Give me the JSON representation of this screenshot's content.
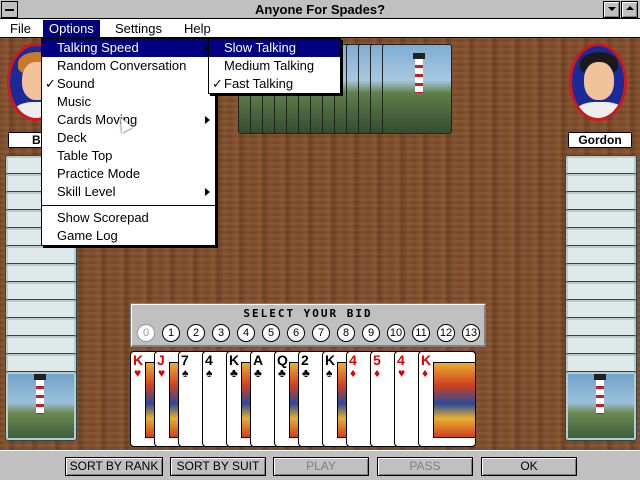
{
  "window": {
    "title": "Anyone For Spades?"
  },
  "menubar": [
    "File",
    "Options",
    "Settings",
    "Help"
  ],
  "options_menu": {
    "items": [
      {
        "label": "Talking Speed",
        "checked": false,
        "submenu": true,
        "highlighted": true
      },
      {
        "label": "Random Conversation",
        "checked": false,
        "submenu": false
      },
      {
        "label": "Sound",
        "checked": true,
        "submenu": false
      },
      {
        "label": "Music",
        "checked": false,
        "submenu": false
      },
      {
        "label": "Cards Moving",
        "checked": false,
        "submenu": true
      },
      {
        "label": "Deck",
        "checked": false,
        "submenu": false
      },
      {
        "label": "Table Top",
        "checked": false,
        "submenu": false
      },
      {
        "label": "Practice Mode",
        "checked": false,
        "submenu": false
      },
      {
        "label": "Skill Level",
        "checked": false,
        "submenu": true
      },
      {
        "label": "Show Scorepad",
        "checked": false,
        "submenu": false
      },
      {
        "label": "Game Log",
        "checked": false,
        "submenu": false
      }
    ]
  },
  "talking_speed_menu": {
    "items": [
      {
        "label": "Slow Talking",
        "checked": false,
        "highlighted": true
      },
      {
        "label": "Medium Talking",
        "checked": false
      },
      {
        "label": "Fast Talking",
        "checked": true
      }
    ]
  },
  "check_mark": "✓",
  "players": {
    "west_name": "Bi",
    "east_name": "Gordon"
  },
  "bid_panel": {
    "title": "SELECT YOUR BID",
    "bids": [
      "0",
      "1",
      "2",
      "3",
      "4",
      "5",
      "6",
      "7",
      "8",
      "9",
      "10",
      "11",
      "12",
      "13"
    ]
  },
  "hand": [
    {
      "rank": "K",
      "suit": "♥",
      "color": "red",
      "face": true
    },
    {
      "rank": "J",
      "suit": "♥",
      "color": "red",
      "face": true
    },
    {
      "rank": "7",
      "suit": "♠",
      "color": "black",
      "face": false
    },
    {
      "rank": "4",
      "suit": "♠",
      "color": "black",
      "face": false
    },
    {
      "rank": "K",
      "suit": "♣",
      "color": "black",
      "face": true
    },
    {
      "rank": "A",
      "suit": "♣",
      "color": "black",
      "face": false
    },
    {
      "rank": "Q",
      "suit": "♣",
      "color": "black",
      "face": true
    },
    {
      "rank": "2",
      "suit": "♣",
      "color": "black",
      "face": false
    },
    {
      "rank": "K",
      "suit": "♠",
      "color": "black",
      "face": true
    },
    {
      "rank": "4",
      "suit": "♦",
      "color": "red",
      "face": false
    },
    {
      "rank": "5",
      "suit": "♦",
      "color": "red",
      "face": false
    },
    {
      "rank": "4",
      "suit": "♥",
      "color": "red",
      "face": false
    },
    {
      "rank": "K",
      "suit": "♦",
      "color": "red",
      "face": true
    }
  ],
  "footer": {
    "sort_rank": "SORT BY RANK",
    "sort_suit": "SORT BY SUIT",
    "play": "PLAY",
    "pass": "PASS",
    "ok": "OK"
  }
}
